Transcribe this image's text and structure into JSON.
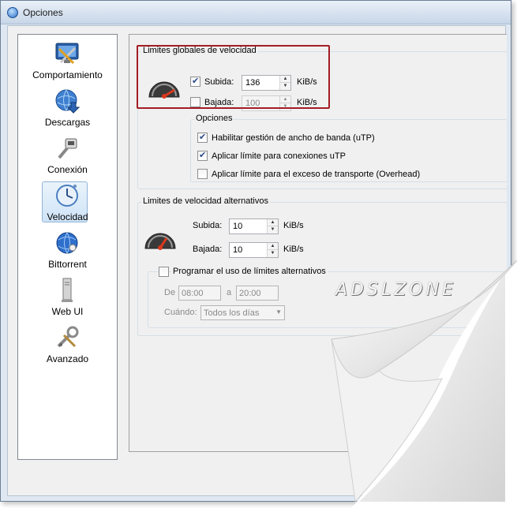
{
  "window": {
    "title": "Opciones"
  },
  "sidebar": {
    "items": [
      {
        "label": "Comportamiento",
        "icon": "monitor-tools-icon"
      },
      {
        "label": "Descargas",
        "icon": "globe-download-icon"
      },
      {
        "label": "Conexión",
        "icon": "ethernet-plug-icon"
      },
      {
        "label": "Velocidad",
        "icon": "clock-speed-icon",
        "selected": true
      },
      {
        "label": "Bittorrent",
        "icon": "globe-network-icon"
      },
      {
        "label": "Web UI",
        "icon": "server-tower-icon"
      },
      {
        "label": "Avanzado",
        "icon": "wrench-screwdriver-icon"
      }
    ]
  },
  "global_limits": {
    "legend": "Limites globales de velocidad",
    "upload": {
      "checked": true,
      "label": "Subida:",
      "value": "136",
      "unit": "KiB/s"
    },
    "download": {
      "checked": false,
      "label": "Bajada:",
      "value": "100",
      "unit": "KiB/s"
    },
    "options": {
      "legend": "Opciones",
      "items": [
        {
          "label": "Habilitar gestión de ancho de banda (uTP)",
          "checked": true
        },
        {
          "label": "Aplicar límite para conexiones uTP",
          "checked": true
        },
        {
          "label": "Aplicar límite para el exceso de transporte (Overhead)",
          "checked": false
        }
      ]
    }
  },
  "alt_limits": {
    "legend": "Limites de velocidad alternativos",
    "upload": {
      "label": "Subida:",
      "value": "10",
      "unit": "KiB/s"
    },
    "download": {
      "label": "Bajada:",
      "value": "10",
      "unit": "KiB/s"
    },
    "schedule": {
      "label": "Programar el uso de límites alternativos",
      "checked": false,
      "from_label": "De",
      "from_value": "08:00",
      "to_label": "a",
      "to_value": "20:00",
      "when_label": "Cuándo:",
      "when_value": "Todos los días"
    }
  },
  "watermark": "ADSLZONE",
  "colors": {
    "highlight": "#a31d24",
    "selection": "#cfe4f7"
  }
}
